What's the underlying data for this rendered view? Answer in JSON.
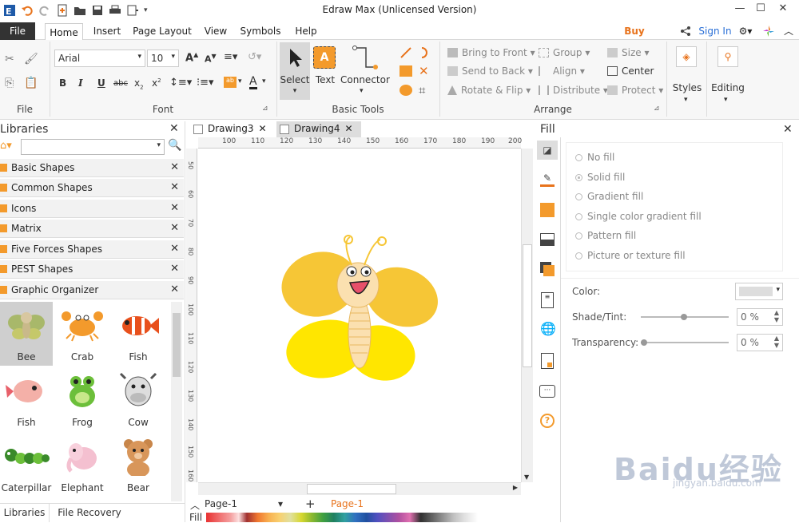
{
  "app": {
    "title": "Edraw Max (Unlicensed Version)"
  },
  "menu": {
    "file": "File",
    "tabs": [
      "Home",
      "Insert",
      "Page Layout",
      "View",
      "Symbols",
      "Help"
    ],
    "buy_now": "Buy Now",
    "sign_in": "Sign In"
  },
  "ribbon": {
    "font": {
      "family": "Arial",
      "size": "10",
      "group_label": "Font"
    },
    "file_group_label": "File",
    "basic_tools": {
      "select": "Select",
      "text": "Text",
      "connector": "Connector",
      "group_label": "Basic Tools"
    },
    "arrange": {
      "bring_to_front": "Bring to Front",
      "send_to_back": "Send to Back",
      "rotate_flip": "Rotate & Flip",
      "group": "Group",
      "align": "Align",
      "distribute": "Distribute",
      "size": "Size",
      "center": "Center",
      "protect": "Protect",
      "group_label": "Arrange"
    },
    "styles": "Styles",
    "editing": "Editing"
  },
  "libraries": {
    "title": "Libraries",
    "search_placeholder": "",
    "categories": [
      "Basic Shapes",
      "Common Shapes",
      "Icons",
      "Matrix",
      "Five Forces Shapes",
      "PEST Shapes",
      "Graphic Organizer"
    ],
    "shapes": [
      "Bee",
      "Crab",
      "Fish",
      "Fish",
      "Frog",
      "Cow",
      "Caterpillar",
      "Elephant",
      "Bear"
    ],
    "bottom_tabs": [
      "Libraries",
      "File Recovery"
    ]
  },
  "documents": {
    "tabs": [
      "Drawing3",
      "Drawing4"
    ],
    "ruler_h": [
      "100",
      "110",
      "120",
      "130",
      "140",
      "150",
      "160",
      "170",
      "180",
      "190",
      "200"
    ],
    "ruler_v": [
      "50",
      "60",
      "70",
      "80",
      "90",
      "100",
      "110",
      "120",
      "130",
      "140",
      "150",
      "160"
    ],
    "page_tab": "Page-1",
    "page_tab_active": "Page-1",
    "fill_label": "Fill"
  },
  "fill_panel": {
    "title": "Fill",
    "options": [
      "No fill",
      "Solid fill",
      "Gradient fill",
      "Single color gradient fill",
      "Pattern fill",
      "Picture or texture fill"
    ],
    "selected": "Solid fill",
    "color_label": "Color:",
    "shade_label": "Shade/Tint:",
    "shade_value": "0 %",
    "transparency_label": "Transparency:",
    "transparency_value": "0 %"
  },
  "watermark": {
    "brand": "Baidu",
    "cn": "经验",
    "url": "jingyan.baidu.com"
  },
  "colors": {
    "accent": "#f39a2c",
    "file_tab": "#333333",
    "buy_now": "#e8731c",
    "sign_in": "#2a6fd6"
  }
}
